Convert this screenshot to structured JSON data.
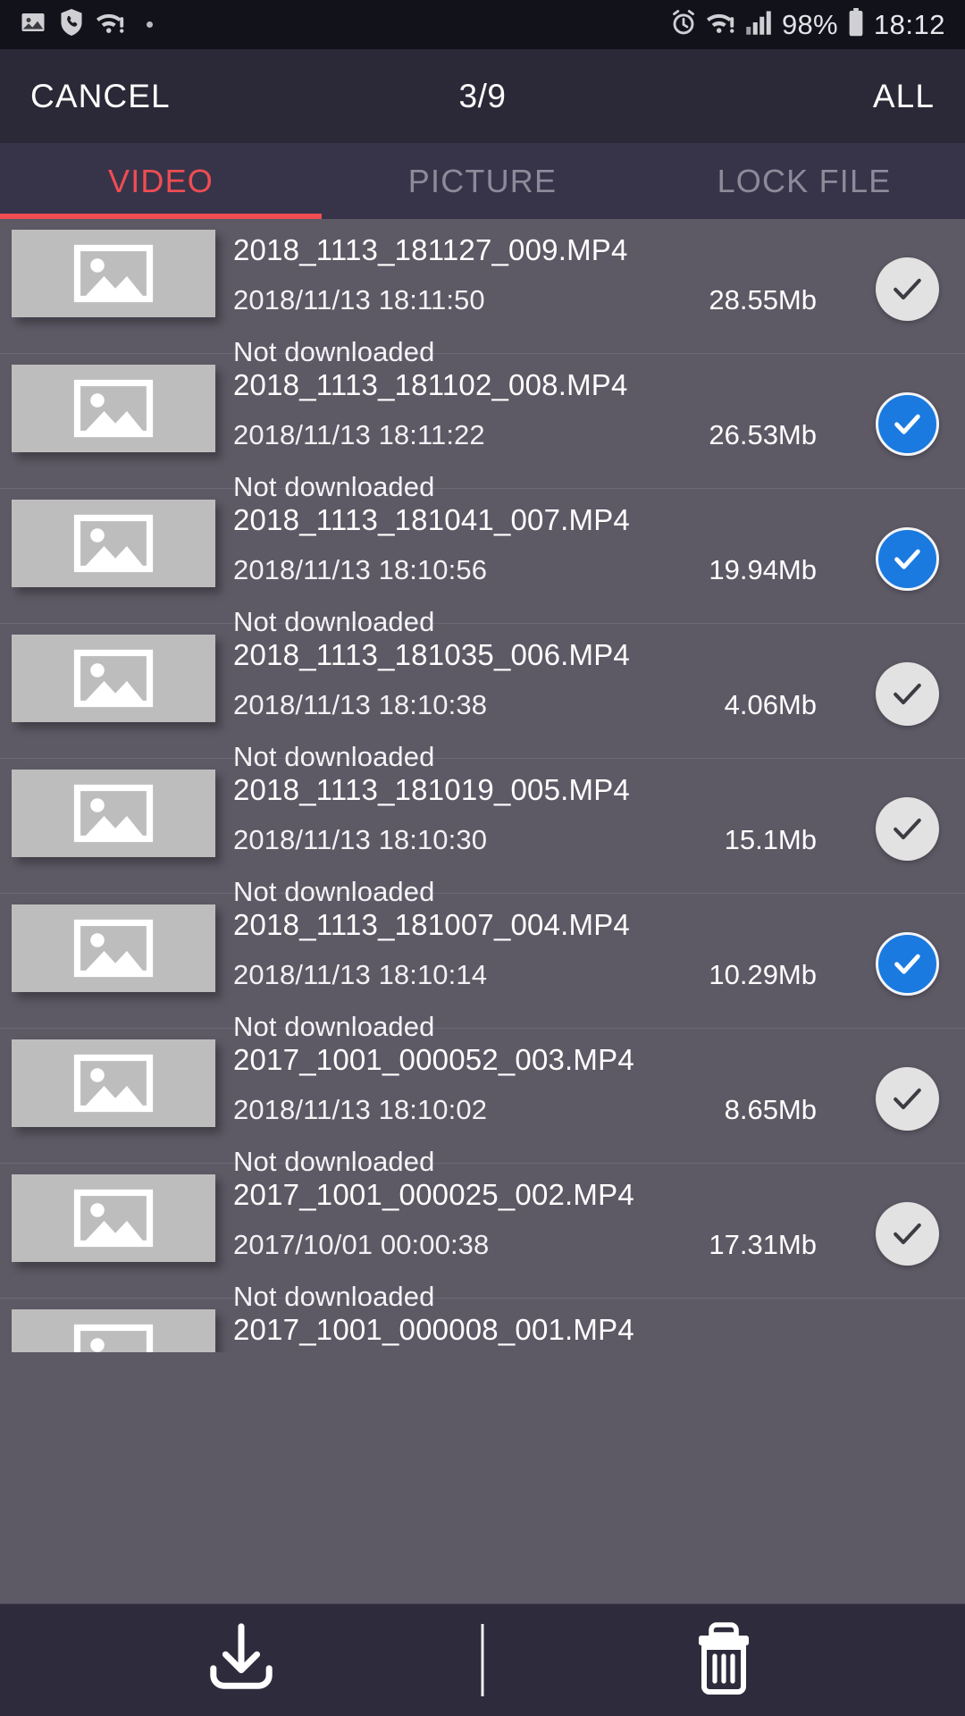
{
  "status_bar": {
    "left_icons": [
      "image-icon",
      "call-shield-icon",
      "wifi-alert-icon",
      "dot-icon"
    ],
    "right_icons": [
      "alarm-icon",
      "wifi-alert-icon",
      "signal-bars-icon",
      "battery-icon"
    ],
    "battery_percent": "98%",
    "time": "18:12"
  },
  "action_bar": {
    "cancel_label": "CANCEL",
    "title": "3/9",
    "all_label": "ALL"
  },
  "tabs": [
    {
      "label": "VIDEO",
      "active": true
    },
    {
      "label": "PICTURE",
      "active": false
    },
    {
      "label": "LOCK FILE",
      "active": false
    }
  ],
  "colors": {
    "accent": "#ef4d52",
    "selected_checkbox": "#1a7ae0",
    "list_background": "#5d5965",
    "bar_background": "#2b2938",
    "status_background": "#12131a"
  },
  "files": [
    {
      "name": "2018_1113_181127_009.MP4",
      "date": "2018/11/13 18:11:50",
      "size": "28.55Mb",
      "status": "Not downloaded",
      "selected": false
    },
    {
      "name": "2018_1113_181102_008.MP4",
      "date": "2018/11/13 18:11:22",
      "size": "26.53Mb",
      "status": "Not downloaded",
      "selected": true
    },
    {
      "name": "2018_1113_181041_007.MP4",
      "date": "2018/11/13 18:10:56",
      "size": "19.94Mb",
      "status": "Not downloaded",
      "selected": true
    },
    {
      "name": "2018_1113_181035_006.MP4",
      "date": "2018/11/13 18:10:38",
      "size": "4.06Mb",
      "status": "Not downloaded",
      "selected": false
    },
    {
      "name": "2018_1113_181019_005.MP4",
      "date": "2018/11/13 18:10:30",
      "size": "15.1Mb",
      "status": "Not downloaded",
      "selected": false
    },
    {
      "name": "2018_1113_181007_004.MP4",
      "date": "2018/11/13 18:10:14",
      "size": "10.29Mb",
      "status": "Not downloaded",
      "selected": true
    },
    {
      "name": "2017_1001_000052_003.MP4",
      "date": "2018/11/13 18:10:02",
      "size": "8.65Mb",
      "status": "Not downloaded",
      "selected": false
    },
    {
      "name": "2017_1001_000025_002.MP4",
      "date": "2017/10/01 00:00:38",
      "size": "17.31Mb",
      "status": "Not downloaded",
      "selected": false
    },
    {
      "name": "2017_1001_000008_001.MP4",
      "date": "",
      "size": "",
      "status": "",
      "selected": false
    }
  ],
  "bottom_bar": {
    "download_icon": "download-icon",
    "delete_icon": "trash-icon"
  }
}
